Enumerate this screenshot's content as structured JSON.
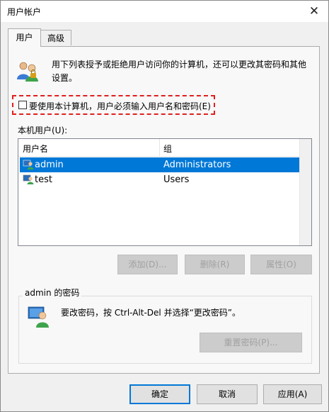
{
  "window": {
    "title": "用户帐户",
    "close_glyph": "✕"
  },
  "tabs": [
    {
      "label": "用户"
    },
    {
      "label": "高级"
    }
  ],
  "intro": {
    "text": "用下列表授予或拒绝用户访问你的计算机，还可以更改其密码和其他设置。"
  },
  "require_login": {
    "label": "要使用本计算机，用户必须输入用户名和密码(E)",
    "checked": false
  },
  "local_users": {
    "label": "本机用户(U):",
    "columns": [
      "用户名",
      "组"
    ],
    "rows": [
      {
        "name": "admin",
        "group": "Administrators",
        "selected": true
      },
      {
        "name": "test",
        "group": "Users",
        "selected": false
      }
    ]
  },
  "user_buttons": {
    "add": "添加(D)...",
    "remove": "删除(R)",
    "properties": "属性(O)"
  },
  "password_group": {
    "label": "admin 的密码",
    "text": "要改密码，按 Ctrl-Alt-Del 并选择“更改密码”。",
    "reset_button": "重置密码(P)..."
  },
  "footer": {
    "ok": "确定",
    "cancel": "取消",
    "apply": "应用(A)"
  },
  "colors": {
    "selection": "#0078d7",
    "highlight_box": "#e02020",
    "panel": "#f8f8f8"
  }
}
